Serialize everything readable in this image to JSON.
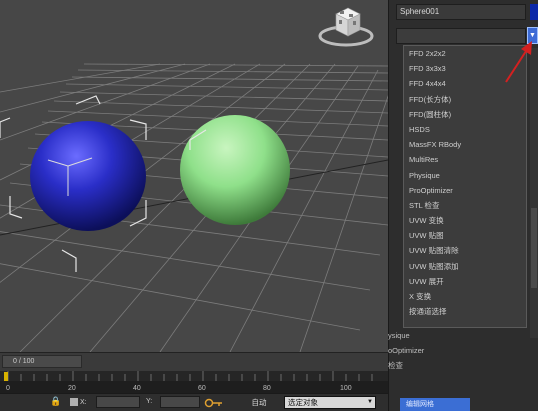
{
  "command_panel": {
    "object_name": "Sphere001",
    "object_color": "#0c28a8",
    "modifier_list_value": "",
    "modifier_menu_items": [
      "FFD 2x2x2",
      "FFD 3x3x3",
      "FFD 4x4x4",
      "FFD(长方体)",
      "FFD(圆柱体)",
      "HSDS",
      "MassFX RBody",
      "MultiRes",
      "Physique",
      "ProOptimizer",
      "STL 检查",
      "UVW 变换",
      "UVW 贴图",
      "UVW 贴图清除",
      "UVW 贴图添加",
      "UVW 展开",
      "X 变换",
      "按通道选择"
    ],
    "list_behind_menu": [
      "ysique",
      "oOptimizer",
      "检查"
    ],
    "edit_poly_label": "编辑网格"
  },
  "timeline": {
    "frame_display": "0 / 100",
    "ticks": [
      "0",
      "20",
      "40",
      "60",
      "80",
      "100"
    ]
  },
  "statusbar": {
    "x_label": "X:",
    "y_label": "Y:",
    "auto_key": "自动",
    "selection_set": "选定对象"
  },
  "colors": {
    "blue_sphere": "#2a2ec8",
    "green_sphere": "#8fe08a",
    "accent": "#3d6bd6",
    "annotation_arrow": "#d42020"
  }
}
